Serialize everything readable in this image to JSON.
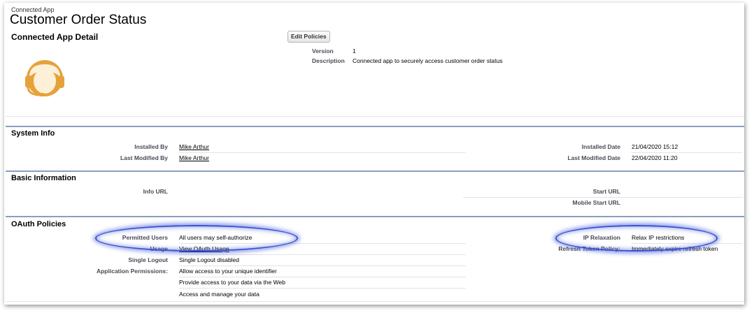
{
  "page": {
    "breadcrumb": "Connected App",
    "title": "Customer Order Status"
  },
  "detail": {
    "heading": "Connected App Detail",
    "edit_button": "Edit Policies",
    "version_label": "Version",
    "version_value": "1",
    "description_label": "Description",
    "description_value": "Connected app to securely access customer order status"
  },
  "system_info": {
    "heading": "System Info",
    "installed_by_label": "Installed By",
    "installed_by_value": "Mike Arthur",
    "last_modified_by_label": "Last Modified By",
    "last_modified_by_value": "Mike Arthur",
    "installed_date_label": "Installed Date",
    "installed_date_value": "21/04/2020 15:12",
    "last_modified_date_label": "Last Modified Date",
    "last_modified_date_value": "22/04/2020 11:20"
  },
  "basic_info": {
    "heading": "Basic Information",
    "info_url_label": "Info URL",
    "start_url_label": "Start URL",
    "mobile_start_url_label": "Mobile Start URL"
  },
  "oauth": {
    "heading": "OAuth Policies",
    "permitted_users_label": "Permitted Users",
    "permitted_users_value": "All users may self-authorize",
    "usage_label": "Usage",
    "usage_value": "View OAuth Usage",
    "single_logout_label": "Single Logout",
    "single_logout_value": "Single Logout disabled",
    "app_permissions_label": "Application Permissions:",
    "app_permissions": [
      "Allow access to your unique identifier",
      "Provide access to your data via the Web",
      "Access and manage your data"
    ],
    "ip_relaxation_label": "IP Relaxation",
    "ip_relaxation_value": "Relax IP restrictions",
    "refresh_token_label": "Refresh Token Policy:",
    "refresh_token_value": "Immediately expire refresh token"
  },
  "colors": {
    "section_bar": "#8a9ebe",
    "highlight": "#3b4fd0",
    "logo_orange": "#e6a23a"
  }
}
